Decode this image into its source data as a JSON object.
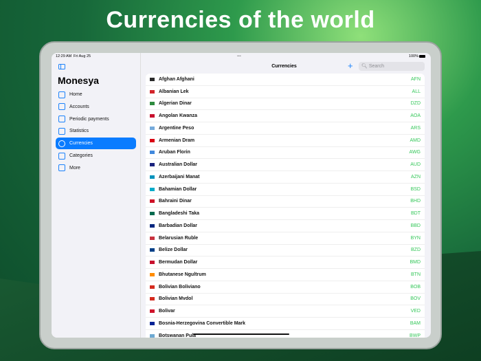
{
  "headline": "Currencies of the world",
  "status": {
    "time": "12:29 AM",
    "date": "Fri Aug 25",
    "battery": "100%",
    "dots": "•••"
  },
  "sidebar": {
    "app_title": "Monesya",
    "items": [
      {
        "label": "Home",
        "icon": "house-icon"
      },
      {
        "label": "Accounts",
        "icon": "bank-icon"
      },
      {
        "label": "Periodic payments",
        "icon": "calendar-icon"
      },
      {
        "label": "Statistics",
        "icon": "clock-chart-icon"
      },
      {
        "label": "Currencies",
        "icon": "dollar-circle-icon",
        "active": true
      },
      {
        "label": "Categories",
        "icon": "categories-icon"
      },
      {
        "label": "More",
        "icon": "more-icon"
      }
    ]
  },
  "main": {
    "title": "Currencies",
    "add": "+",
    "search_placeholder": "Search"
  },
  "accent": "#0a7cff",
  "code_color": "#34c759",
  "currencies": [
    {
      "name": "Afghan Afghani",
      "code": "AFN",
      "flag": "#2a2a2a"
    },
    {
      "name": "Albanian Lek",
      "code": "ALL",
      "flag": "#d2242a"
    },
    {
      "name": "Algerian Dinar",
      "code": "DZD",
      "flag": "#2e8b3e"
    },
    {
      "name": "Angolan Kwanza",
      "code": "AOA",
      "flag": "#c8102e"
    },
    {
      "name": "Argentine Peso",
      "code": "ARS",
      "flag": "#75aadb"
    },
    {
      "name": "Armenian Dram",
      "code": "AMD",
      "flag": "#d90012"
    },
    {
      "name": "Aruban Florin",
      "code": "AWG",
      "flag": "#4189dd"
    },
    {
      "name": "Australian Dollar",
      "code": "AUD",
      "flag": "#1a237e"
    },
    {
      "name": "Azerbaijani Manat",
      "code": "AZN",
      "flag": "#0092bc"
    },
    {
      "name": "Bahamian Dollar",
      "code": "BSD",
      "flag": "#00abc9"
    },
    {
      "name": "Bahraini Dinar",
      "code": "BHD",
      "flag": "#ce1126"
    },
    {
      "name": "Bangladeshi Taka",
      "code": "BDT",
      "flag": "#006a4e"
    },
    {
      "name": "Barbadian Dollar",
      "code": "BBD",
      "flag": "#00267f"
    },
    {
      "name": "Belarusian Ruble",
      "code": "BYN",
      "flag": "#c8313e"
    },
    {
      "name": "Belize Dollar",
      "code": "BZD",
      "flag": "#003f87"
    },
    {
      "name": "Bermudan Dollar",
      "code": "BMD",
      "flag": "#c8102e"
    },
    {
      "name": "Bhutanese Ngultrum",
      "code": "BTN",
      "flag": "#ff8c00"
    },
    {
      "name": "Bolivian Boliviano",
      "code": "BOB",
      "flag": "#d52b1e"
    },
    {
      "name": "Bolivian Mvdol",
      "code": "BOV",
      "flag": "#d52b1e"
    },
    {
      "name": "Bolivar",
      "code": "VED",
      "flag": "#cf142b"
    },
    {
      "name": "Bosnia-Herzegovina Convertible Mark",
      "code": "BAM",
      "flag": "#002395"
    },
    {
      "name": "Botswanan Pula",
      "code": "BWP",
      "flag": "#6da9d2"
    }
  ]
}
